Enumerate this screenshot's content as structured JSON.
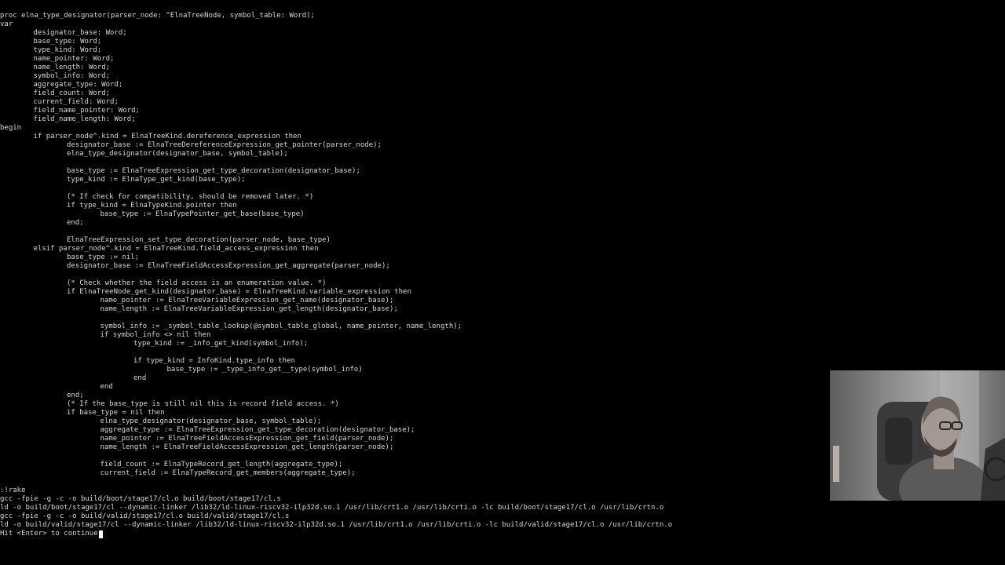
{
  "code_lines": [
    "proc elna_type_designator(parser_node: ^ElnaTreeNode, symbol_table: Word);",
    "var",
    "\tdesignator_base: Word;",
    "\tbase_type: Word;",
    "\ttype_kind: Word;",
    "\tname_pointer: Word;",
    "\tname_length: Word;",
    "\tsymbol_info: Word;",
    "\taggregate_type: Word;",
    "\tfield_count: Word;",
    "\tcurrent_field: Word;",
    "\tfield_name_pointer: Word;",
    "\tfield_name_length: Word;",
    "begin",
    "\tif parser_node^.kind = ElnaTreeKind.dereference_expression then",
    "\t\tdesignator_base := ElnaTreeDereferenceExpression_get_pointer(parser_node);",
    "\t\telna_type_designator(designator_base, symbol_table);",
    "",
    "\t\tbase_type := ElnaTreeExpression_get_type_decoration(designator_base);",
    "\t\ttype_kind := ElnaType_get_kind(base_type);",
    "",
    "\t\t(* If check for compatibility, should be removed later. *)",
    "\t\tif type_kind = ElnaTypeKind.pointer then",
    "\t\t\tbase_type := ElnaTypePointer_get_base(base_type)",
    "\t\tend;",
    "",
    "\t\tElnaTreeExpression_set_type_decoration(parser_node, base_type)",
    "\telsif parser_node^.kind = ElnaTreeKind.field_access_expression then",
    "\t\tbase_type := nil;",
    "\t\tdesignator_base := ElnaTreeFieldAccessExpression_get_aggregate(parser_node);",
    "",
    "\t\t(* Check whether the field access is an enumeration value. *)",
    "\t\tif ElnaTreeNode_get_kind(designator_base) = ElnaTreeKind.variable_expression then",
    "\t\t\tname_pointer := ElnaTreeVariableExpression_get_name(designator_base);",
    "\t\t\tname_length := ElnaTreeVariableExpression_get_length(designator_base);",
    "",
    "\t\t\tsymbol_info := _symbol_table_lookup(@symbol_table_global, name_pointer, name_length);",
    "\t\t\tif symbol_info <> nil then",
    "\t\t\t\ttype_kind := _info_get_kind(symbol_info);",
    "",
    "\t\t\t\tif type_kind = InfoKind.type_info then",
    "\t\t\t\t\tbase_type := _type_info_get__type(symbol_info)",
    "\t\t\t\tend",
    "\t\t\tend",
    "\t\tend;",
    "\t\t(* If the base_type is still nil this is record field access. *)",
    "\t\tif base_type = nil then",
    "\t\t\telna_type_designator(designator_base, symbol_table);",
    "\t\t\taggregate_type := ElnaTreeExpression_get_type_decoration(designator_base);",
    "\t\t\tname_pointer := ElnaTreeFieldAccessExpression_get_field(parser_node);",
    "\t\t\tname_length := ElnaTreeFieldAccessExpression_get_length(parser_node);",
    "",
    "\t\t\tfield_count := ElnaTypeRecord_get_length(aggregate_type);",
    "\t\t\tcurrent_field := ElnaTypeRecord_get_members(aggregate_type);"
  ],
  "output_lines": [
    ":!rake",
    "gcc -fpie -g -c -o build/boot/stage17/cl.o build/boot/stage17/cl.s",
    "ld -o build/boot/stage17/cl --dynamic-linker /lib32/ld-linux-riscv32-ilp32d.so.1 /usr/lib/crt1.o /usr/lib/crti.o -lc build/boot/stage17/cl.o /usr/lib/crtn.o",
    "gcc -fpie -g -c -o build/valid/stage17/cl.o build/valid/stage17/cl.s",
    "ld -o build/valid/stage17/cl --dynamic-linker /lib32/ld-linux-riscv32-ilp32d.so.1 /usr/lib/crt1.o /usr/lib/crti.o -lc build/valid/stage17/cl.o /usr/lib/crtn.o",
    "Hit <Enter> to continue"
  ]
}
